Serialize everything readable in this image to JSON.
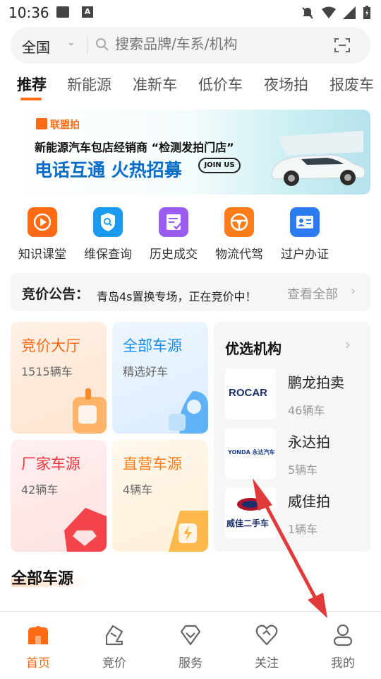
{
  "status_bar": {
    "time": "10:36",
    "a_badge": "A"
  },
  "search": {
    "region": "全国",
    "placeholder": "搜索品牌/车系/机构"
  },
  "tabs": [
    "推荐",
    "新能源",
    "准新车",
    "低价车",
    "夜场拍",
    "报废车"
  ],
  "banner": {
    "brand": "联盟拍",
    "line1": "新能源汽车包店经销商 “检测发拍门店”",
    "line2": "电话互通 火热招募",
    "join": "JOIN US"
  },
  "quick_nav": [
    {
      "label": "知识课堂",
      "icon": "play-icon",
      "color": "#ff6a13"
    },
    {
      "label": "维保查询",
      "icon": "search-shield-icon",
      "color": "#1a9af0"
    },
    {
      "label": "历史成交",
      "icon": "checklist-icon",
      "color": "#9a5cf0"
    },
    {
      "label": "物流代驾",
      "icon": "steering-wheel-icon",
      "color": "#ff7d19"
    },
    {
      "label": "过户办证",
      "icon": "id-card-icon",
      "color": "#2b7cf0"
    }
  ],
  "announcement": {
    "title": "竞价公告：",
    "text": "青岛4s置换专场，正在竞价中！",
    "more": "查看全部"
  },
  "tiles": [
    {
      "title": "竞价大厅",
      "sub": "1515辆车",
      "title_color": "#ff6a13"
    },
    {
      "title": "全部车源",
      "sub": "精选好车",
      "title_color": "#1a8ef0"
    },
    {
      "title": "厂家车源",
      "sub": "42辆车",
      "title_color": "#f0353b"
    },
    {
      "title": "直营车源",
      "sub": "4辆车",
      "title_color": "#ff7d19"
    }
  ],
  "org_panel": {
    "title": "优选机构",
    "items": [
      {
        "name": "鹏龙拍卖",
        "count": "46辆车",
        "logo_text": "ROCAR"
      },
      {
        "name": "永达拍",
        "count": "5辆车",
        "logo_text": "YONDA 永达汽车"
      },
      {
        "name": "威佳拍",
        "count": "1辆车",
        "logo_text": "威佳二手车"
      }
    ]
  },
  "section_title": "全部车源",
  "bottom_nav": [
    {
      "label": "首页",
      "icon": "home-icon"
    },
    {
      "label": "竞价",
      "icon": "auction-icon"
    },
    {
      "label": "服务",
      "icon": "diamond-icon"
    },
    {
      "label": "关注",
      "icon": "heart-icon"
    },
    {
      "label": "我的",
      "icon": "profile-icon"
    }
  ],
  "colors": {
    "accent": "#ff6a13",
    "annotation_arrow": "#e03a3a"
  }
}
